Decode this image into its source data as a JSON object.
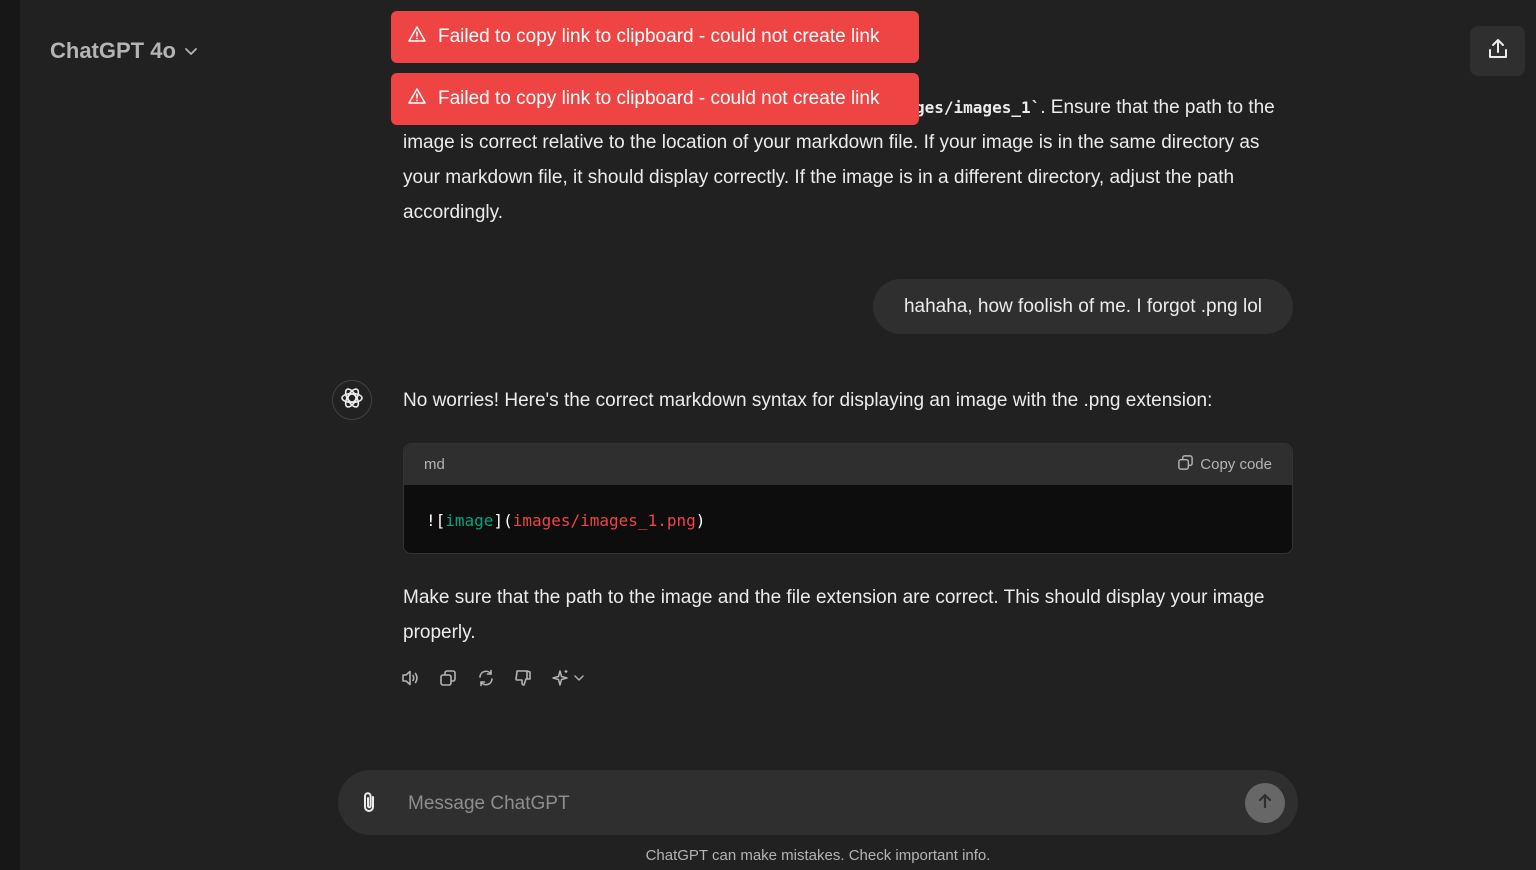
{
  "header": {
    "model_name": "ChatGPT 4o",
    "share_icon": "share-icon"
  },
  "toasts": [
    {
      "icon": "warning-icon",
      "message": "Failed to copy link to clipboard - could not create link",
      "color": "#ef4444"
    },
    {
      "icon": "warning-icon",
      "message": "Failed to copy link to clipboard - could not create link",
      "color": "#ef4444"
    }
  ],
  "conversation": {
    "assistant_msg_1": {
      "visible_code_fragment": "ges/images_1`",
      "line_1_rest": ". Ensure that the path to the",
      "continuation": "image is correct relative to the location of your markdown file. If your image is in the same directory as your markdown file, it should display correctly. If the image is in a different directory, adjust the path accordingly."
    },
    "user_msg": "hahaha, how foolish of me. I forgot .png lol",
    "assistant_msg_2": {
      "avatar_icon": "openai-logo-icon",
      "intro": "No worries! Here's the correct markdown syntax for displaying an image with the .png extension:",
      "code_block": {
        "language": "md",
        "copy_label": "Copy code",
        "tokens": {
          "bang_bracket": "![",
          "alt_text": "image",
          "close_open": "](",
          "path": "images/images_1.png",
          "close": ")"
        }
      },
      "outro": "Make sure that the path to the image and the file extension are correct. This should display your image properly.",
      "actions": [
        "read-aloud-icon",
        "copy-icon",
        "regenerate-icon",
        "thumbs-down-icon",
        "sparkle-model-icon"
      ]
    }
  },
  "composer": {
    "placeholder": "Message ChatGPT",
    "value": "",
    "attach_icon": "paperclip-icon",
    "send_icon": "arrow-up-icon"
  },
  "footer": {
    "disclaimer": "ChatGPT can make mistakes. Check important info."
  },
  "colors": {
    "background": "#212121",
    "surface": "#2f2f2f",
    "toast_error": "#ef4444",
    "code_green": "#00a67d",
    "code_red": "#ef4444"
  }
}
